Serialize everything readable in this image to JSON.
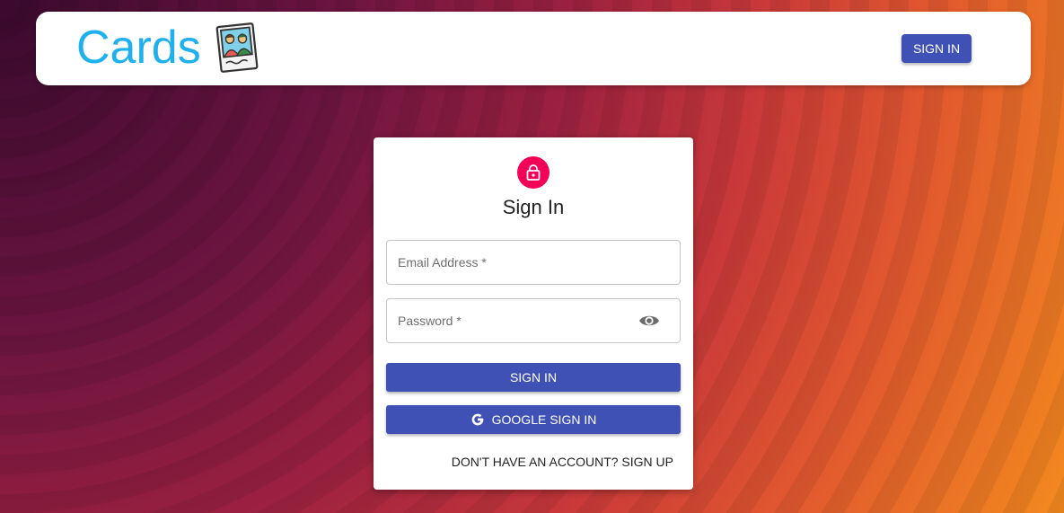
{
  "header": {
    "brand": "Cards",
    "brand_icon": "photo-card-icon",
    "signin_label": "SIGN IN",
    "brand_color": "#1fb0ee"
  },
  "card": {
    "icon": "lock-icon",
    "title": "Sign In",
    "email_placeholder": "Email Address *",
    "password_placeholder": "Password *",
    "visibility_icon": "eye-icon",
    "signin_label": "SIGN IN",
    "google_icon": "google-g-icon",
    "google_label": "GOOGLE SIGN IN",
    "signup_label": "DON'T HAVE AN ACCOUNT? SIGN UP"
  },
  "colors": {
    "primary": "#3f51b5",
    "accent": "#f50057"
  }
}
